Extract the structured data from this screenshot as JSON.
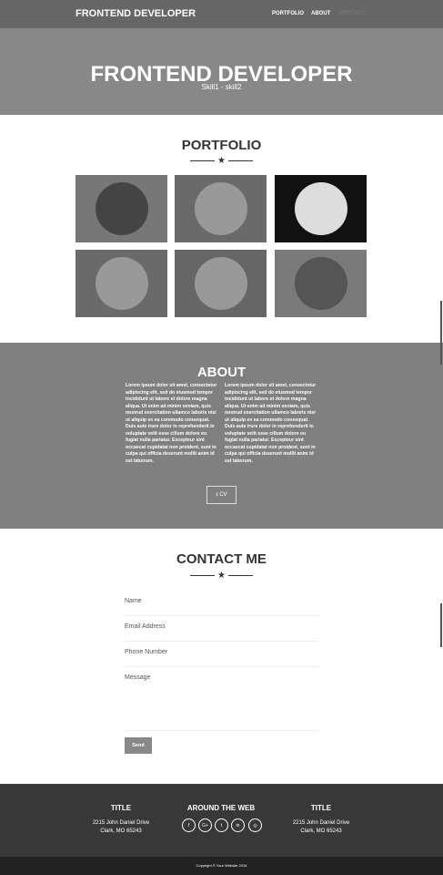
{
  "nav": {
    "brand": "FRONTEND DEVELOPER",
    "links": [
      "PORTFOLIO",
      "ABOUT",
      "CONTACT"
    ]
  },
  "hero": {
    "title": "FRONTEND DEVELOPER",
    "subtitle": "Skill1 - skill2"
  },
  "portfolio": {
    "title": "PORTFOLIO",
    "items": [
      {
        "icon": "cabin-icon"
      },
      {
        "icon": "cake-icon"
      },
      {
        "icon": "circus-tent-icon"
      },
      {
        "icon": "game-controller-icon"
      },
      {
        "icon": "safe-icon"
      },
      {
        "icon": "submarine-icon"
      }
    ]
  },
  "about": {
    "title": "ABOUT",
    "col1": "Lorem ipsum dolor sit amet, consectetur adipiscing elit, sed do eiusmod tempor incididunt ut labore et dolore magna aliqua. Ut enim ad minim veniam, quis nostrud exercitation ullamco laboris nisi ut aliquip ex ea commodo consequat. Duis aute irure dolor in reprehenderit in voluptate velit esse cillum dolore eu fugiat nulla pariatur. Excepteur sint occaecat cupidatat non proident, sunt in culpa qui officia deserunt mollit anim id est laborum.",
    "col2": "Lorem ipsum dolor sit amet, consectetur adipiscing elit, sed do eiusmod tempor incididunt ut labore et dolore magna aliqua. Ut enim ad minim veniam, quis nostrud exercitation ullamco laboris nisi ut aliquip ex ea commodo consequat. Duis aute irure dolor in reprehenderit in voluptate velit esse cillum dolore eu fugiat nulla pariatur. Excepteur sint occaecat cupidatat non proident, sunt in culpa qui officia deserunt mollit anim id est laborum.",
    "cv_label": "CV"
  },
  "contact": {
    "title": "CONTACT ME",
    "fields": {
      "name": "Name",
      "email": "Email Address",
      "phone": "Phone Number",
      "message": "Message"
    },
    "send_label": "Send"
  },
  "footer": {
    "left": {
      "title": "TITLE",
      "line1": "2215 John Daniel Drive",
      "line2": "Clark, MO 65243"
    },
    "middle": {
      "title": "AROUND THE WEB",
      "social": [
        "f",
        "G+",
        "t",
        "in",
        "◎"
      ]
    },
    "right": {
      "title": "TITLE",
      "line1": "2215 John Daniel Drive",
      "line2": "Clark, MO 65243"
    },
    "copyright": "Copyright © Your Website 2016"
  }
}
